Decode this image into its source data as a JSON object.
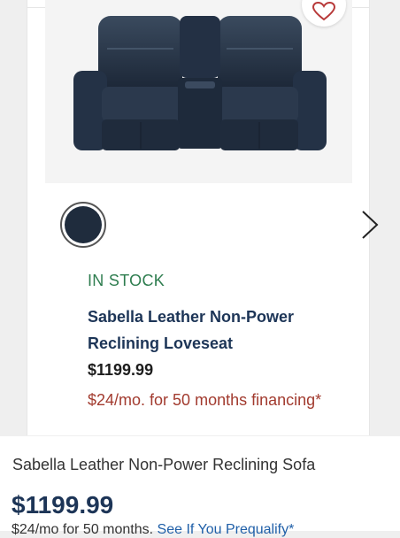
{
  "product_card": {
    "stock_status": "IN STOCK",
    "title": "Sabella Leather Non-Power Reclining Loveseat",
    "price": "$1199.99",
    "financing": "$24/mo. for 50 months financing*",
    "swatch_color": "#1f2c3d"
  },
  "next_product": {
    "title": "Sabella Leather Non-Power Reclining Sofa",
    "price": "$1199.99",
    "financing_text": "$24/mo for 50 months.",
    "prequalify_link": "See If You Prequalify*"
  },
  "colors": {
    "stock_green": "#2e7d4f",
    "title_navy": "#1d3557",
    "financing_red": "#a23b2f",
    "link_blue": "#1f5fa8",
    "heart_red": "#b83a3a"
  },
  "icons": {
    "favorite": "heart-outline-icon",
    "next": "chevron-right-icon"
  }
}
